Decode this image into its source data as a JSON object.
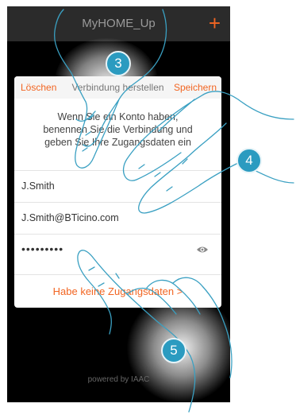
{
  "app": {
    "title": "MyHOME_Up",
    "add_label": "+"
  },
  "dialog": {
    "cancel_label": "Löschen",
    "title": "Verbindung herstellen",
    "save_label": "Speichern",
    "description": "Wenn Sie ein Konto haben, benennen Sie die Verbindung und geben Sie Ihre Zugangsdaten ein",
    "name_value": "J.Smith",
    "email_value": "J.Smith@BTicino.com",
    "password_value": "•••••••••",
    "no_credentials_link": "Habe keine Zugangsdaten >"
  },
  "footer": {
    "text": "powered by IAAC"
  },
  "steps": {
    "step3": "3",
    "step4": "4",
    "step5": "5"
  },
  "colors": {
    "accent": "#f26522",
    "badge": "#2b9bc0",
    "background": "#000000",
    "topbar": "#2b2b2b"
  },
  "icons": {
    "add": "plus-icon",
    "eye": "eye-icon"
  }
}
